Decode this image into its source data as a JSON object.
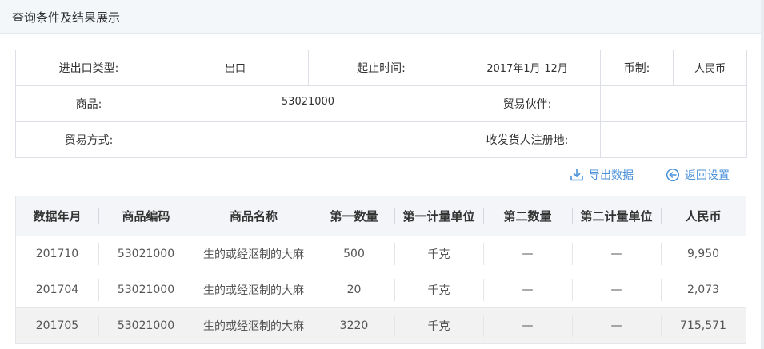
{
  "header": {
    "title": "查询条件及结果展示"
  },
  "conditions": {
    "trade_type_label": "进出口类型:",
    "trade_type_value": "出口",
    "period_label": "起止时间:",
    "period_value": "2017年1月-12月",
    "currency_label": "币制:",
    "currency_value": "人民币",
    "product_label": "商品:",
    "product_value": "53021000",
    "partner_label": "贸易伙伴:",
    "partner_value": "",
    "trade_mode_label": "贸易方式:",
    "trade_mode_value": "",
    "consignor_label": "收发货人注册地:",
    "consignor_value": ""
  },
  "actions": {
    "export_label": "导出数据",
    "export_icon": "download-icon",
    "back_label": "返回设置",
    "back_icon": "arrow-left-circle-icon",
    "link_color": "#4a90d9"
  },
  "results": {
    "columns": [
      "数据年月",
      "商品编码",
      "商品名称",
      "第一数量",
      "第一计量单位",
      "第二数量",
      "第二计量单位",
      "人民币"
    ],
    "rows": [
      [
        "201710",
        "53021000",
        "生的或经沤制的大麻",
        "500",
        "千克",
        "—",
        "—",
        "9,950"
      ],
      [
        "201704",
        "53021000",
        "生的或经沤制的大麻",
        "20",
        "千克",
        "—",
        "—",
        "2,073"
      ],
      [
        "201705",
        "53021000",
        "生的或经沤制的大麻",
        "3220",
        "千克",
        "—",
        "—",
        "715,571"
      ]
    ]
  }
}
